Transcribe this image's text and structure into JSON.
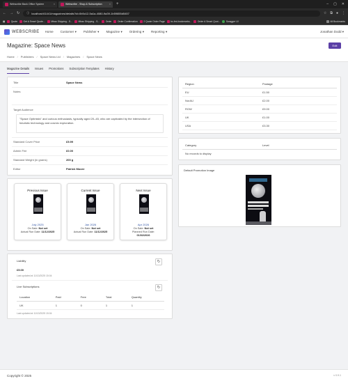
{
  "browser": {
    "tabs": [
      {
        "title": "Webscribe Back Office System"
      },
      {
        "title": "Webscribe - Shop & Subscription"
      }
    ],
    "url": "localhost:61441/magazines/details?id=0b5c12-5a1a-4080-9a39-1b59855d5457",
    "bookmarks": [
      "Quote",
      "Get A Smart Quote...",
      "Mbao Shipping - S...",
      "Mbao Shipping - S...",
      "Order",
      "Order Confirmation",
      "2 Quote Order Page",
      "bc-fed-bookmarks...",
      "Order A Smart Quot...",
      "Swagger UI"
    ],
    "all_bookmarks": "All Bookmarks"
  },
  "nav": {
    "brand": "WEBSCRIBE",
    "items": [
      "Home",
      "Customer",
      "Publisher",
      "Magazine",
      "Ordering",
      "Reporting"
    ],
    "user": "Jonathan Dodd"
  },
  "header": {
    "title": "Magazine: Space News",
    "edit_label": "Edit"
  },
  "breadcrumb": [
    "Home",
    "Publishers",
    "Space News Ltd",
    "Magazines",
    "Space News"
  ],
  "tabs": [
    "Magazine Details",
    "Issues",
    "Promotions",
    "Subscription Templates",
    "History"
  ],
  "details": {
    "title_label": "Title",
    "title_value": "Space News",
    "notes_label": "Notes",
    "audience_label": "Target Audience",
    "audience_value": "\"Space Optimists\" and curious enthusiasts, typically aged 20–45, who are captivated by the intersection of futuristic technology and cosmic exploration.",
    "cover_price_label": "Standard Cover Price",
    "cover_price_value": "£5.99",
    "admin_fee_label": "Admin Fee",
    "admin_fee_value": "£0.00",
    "weight_label": "Standard Weight (in grams)",
    "weight_value": "200 g",
    "editor_label": "Editor",
    "editor_value": "Patrick Moore"
  },
  "issues": [
    {
      "heading": "Previous Issue",
      "date": "July 2025",
      "line1_label": "On Sale:",
      "line1_value": "Not set",
      "line2_label": "Actual Run Date:",
      "line2_value": "11/12/2025",
      "line3": ""
    },
    {
      "heading": "Current Issue",
      "date": "Jan 2026",
      "line1_label": "On Sale:",
      "line1_value": "Not set",
      "line2_label": "Actual Run Date:",
      "line2_value": "11/12/2025",
      "line3": ""
    },
    {
      "heading": "Next Issue",
      "date": "Apr 2026",
      "line1_label": "On Sale:",
      "line1_value": "Not set",
      "line2_label": "Planned Run Date:",
      "line2_value": "",
      "line3": "01/02/2026"
    }
  ],
  "liability": {
    "label": "Liability",
    "value": "£5.00",
    "updated": "Last updated at 11/13/2025 15:04"
  },
  "live_subs": {
    "label": "Live Subscriptions",
    "columns": [
      "Location",
      "Paid",
      "Free",
      "Total",
      "Quantity"
    ],
    "rows": [
      [
        "UK",
        "1",
        "0",
        "1",
        "1"
      ]
    ],
    "updated": "Last updated at 11/13/2025 15:04"
  },
  "postage": {
    "columns": [
      "Region",
      "Postage"
    ],
    "rows": [
      [
        "EU",
        "£1.50"
      ],
      [
        "NorAU",
        "£2.00"
      ],
      [
        "ROW",
        "£9.00"
      ],
      [
        "UK",
        "£1.00"
      ],
      [
        "USA",
        "£3.30"
      ]
    ]
  },
  "category": {
    "columns": [
      "Category",
      "Level"
    ],
    "empty": "No records to display"
  },
  "promo": {
    "label": "Default Promotion Image"
  },
  "footer": {
    "copyright": "Copyright © 2025",
    "version": "v 0.9.1"
  }
}
